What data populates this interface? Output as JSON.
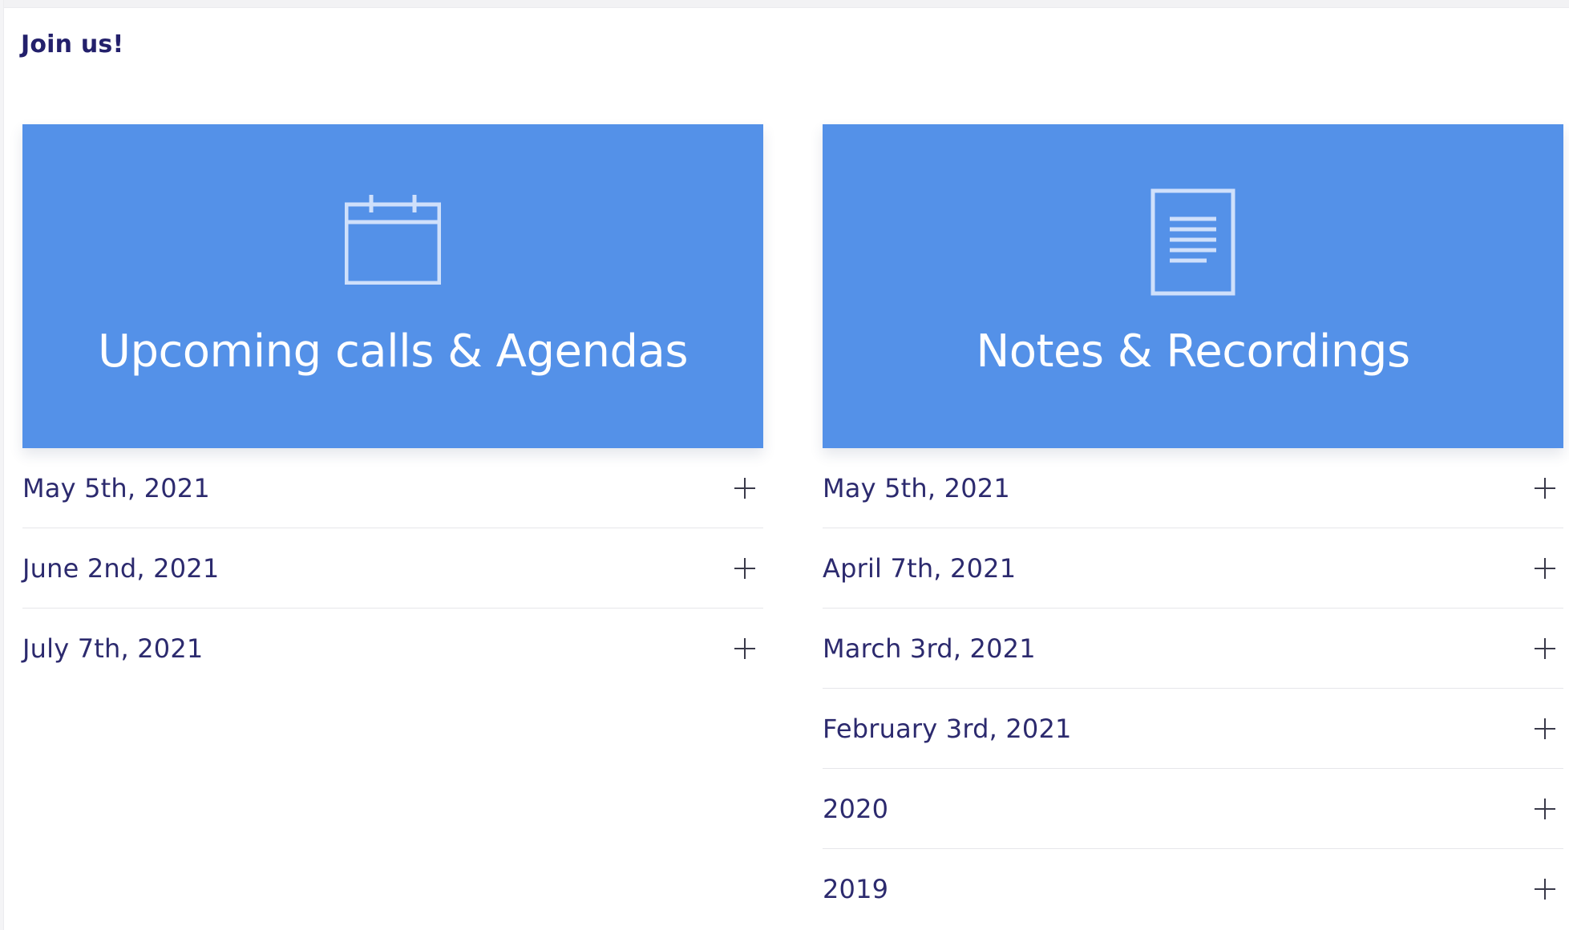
{
  "page": {
    "title": "Join us!"
  },
  "colors": {
    "hero_background": "#5491e8",
    "heading_text": "#23206b",
    "item_text": "#2c2a6e",
    "divider": "#e6e6ea"
  },
  "left_panel": {
    "icon": "calendar-icon",
    "label": "Upcoming calls & Agendas",
    "items": [
      {
        "label": "May 5th, 2021",
        "toggle_icon": "plus-icon"
      },
      {
        "label": "June 2nd, 2021",
        "toggle_icon": "plus-icon"
      },
      {
        "label": "July 7th, 2021",
        "toggle_icon": "plus-icon"
      }
    ]
  },
  "right_panel": {
    "icon": "document-icon",
    "label": "Notes & Recordings",
    "items": [
      {
        "label": "May 5th, 2021",
        "toggle_icon": "plus-icon"
      },
      {
        "label": "April 7th, 2021",
        "toggle_icon": "plus-icon"
      },
      {
        "label": "March 3rd, 2021",
        "toggle_icon": "plus-icon"
      },
      {
        "label": "February 3rd, 2021",
        "toggle_icon": "plus-icon"
      },
      {
        "label": "2020",
        "toggle_icon": "plus-icon"
      },
      {
        "label": "2019",
        "toggle_icon": "plus-icon"
      }
    ]
  }
}
